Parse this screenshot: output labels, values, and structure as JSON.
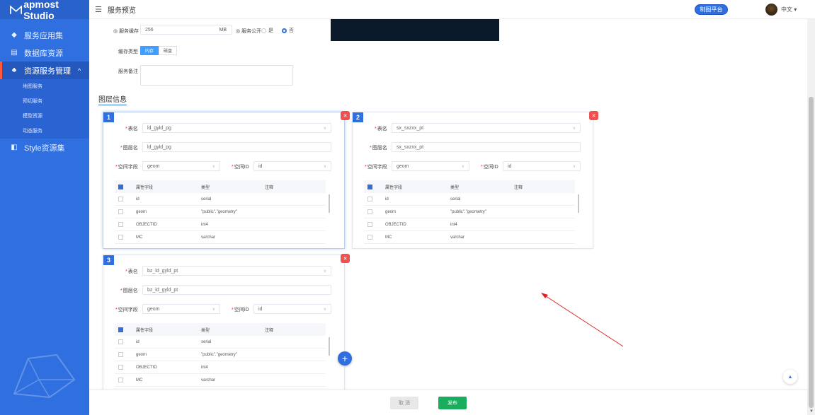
{
  "app": {
    "brand": "apmost Studio",
    "page_title": "服务预览",
    "platform_button": "制图平台",
    "lang_label": "中文"
  },
  "sidebar": {
    "items": [
      {
        "label": "服务应用集",
        "icon": "layers-icon"
      },
      {
        "label": "数据库资源",
        "icon": "database-icon"
      },
      {
        "label": "资源服务管理",
        "icon": "cluster-icon",
        "expanded": true
      },
      {
        "label": "Style资源集",
        "icon": "style-icon"
      }
    ],
    "sub_items": [
      "地图服务",
      "预切服务",
      "模型资源",
      "动态服务"
    ]
  },
  "form": {
    "cache_label": "服务缓存",
    "cache_value": "256",
    "cache_unit": "MB",
    "public_label": "服务公开",
    "public_yes": "是",
    "public_no": "否",
    "public_selected": "否",
    "cache_type_label": "缓存类型",
    "cache_type_options": [
      "内存",
      "磁盘"
    ],
    "cache_type_selected": "内存",
    "remark_label": "服务备注",
    "remark_value": ""
  },
  "layers": {
    "section_title": "图层信息",
    "labels": {
      "table": "表名",
      "layer_name": "图层名",
      "geom_field": "空间字段",
      "srid": "空间ID",
      "col_attr": "属性字段",
      "col_type": "类型",
      "col_note": "注释"
    },
    "cards": [
      {
        "index": "1",
        "table": "ld_gyld_pg",
        "layer_name": "ld_gyld_pg",
        "geom_field": "geom",
        "srid": "id",
        "rows": [
          {
            "name": "id",
            "type": "serial",
            "note": ""
          },
          {
            "name": "geom",
            "type": "\"public\".\"geometry\"",
            "note": ""
          },
          {
            "name": "OBJECTID",
            "type": "int4",
            "note": ""
          },
          {
            "name": "MC",
            "type": "varchar",
            "note": ""
          }
        ]
      },
      {
        "index": "2",
        "table": "sx_sxzxx_pt",
        "layer_name": "sx_sxzxx_pt",
        "geom_field": "geom",
        "srid": "id",
        "rows": [
          {
            "name": "id",
            "type": "serial",
            "note": ""
          },
          {
            "name": "geom",
            "type": "\"public\".\"geometry\"",
            "note": ""
          },
          {
            "name": "OBJECTID",
            "type": "int4",
            "note": ""
          },
          {
            "name": "MC",
            "type": "varchar",
            "note": ""
          }
        ]
      },
      {
        "index": "3",
        "table": "bz_ld_gyld_pt",
        "layer_name": "bz_ld_gyld_pt",
        "geom_field": "geom",
        "srid": "id",
        "rows": [
          {
            "name": "id",
            "type": "serial",
            "note": ""
          },
          {
            "name": "geom",
            "type": "\"public\".\"geometry\"",
            "note": ""
          },
          {
            "name": "OBJECTID",
            "type": "int4",
            "note": ""
          },
          {
            "name": "MC",
            "type": "varchar",
            "note": ""
          }
        ]
      }
    ]
  },
  "footer": {
    "cancel": "取 消",
    "publish": "发布"
  },
  "colors": {
    "sidebar": "#2f6fe0",
    "accent": "#2f6fe0",
    "danger": "#f05050",
    "publish": "#1aad5e"
  }
}
